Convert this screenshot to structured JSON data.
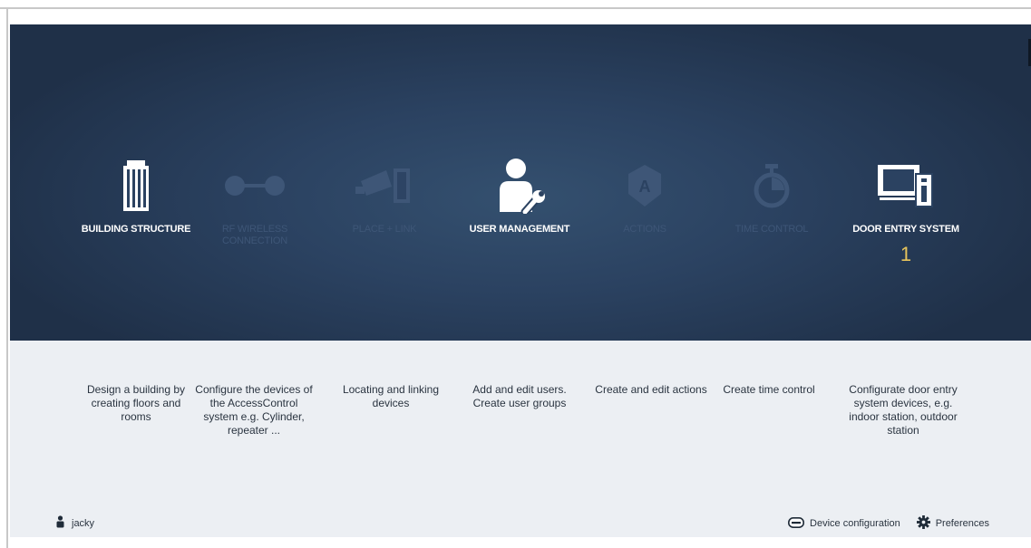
{
  "tiles": [
    {
      "label": "BUILDING STRUCTURE",
      "icon": "building-icon",
      "enabled": true,
      "description": "Design a building by creating floors and rooms"
    },
    {
      "label": "RF WIRELESS CONNECTION",
      "icon": "rf-connection-icon",
      "enabled": false,
      "description": "Configure the devices of the AccessControl system e.g. Cylinder, repeater ..."
    },
    {
      "label": "PLACE + LINK",
      "icon": "place-link-icon",
      "enabled": false,
      "description": "Locating and linking devices"
    },
    {
      "label": "USER MANAGEMENT",
      "icon": "user-management-icon",
      "enabled": true,
      "description": "Add and edit users. Create user groups"
    },
    {
      "label": "ACTIONS",
      "icon": "actions-icon",
      "enabled": false,
      "description": "Create and edit actions"
    },
    {
      "label": "TIME CONTROL",
      "icon": "stopwatch-icon",
      "enabled": false,
      "description": "Create time control"
    },
    {
      "label": "DOOR ENTRY SYSTEM",
      "icon": "door-entry-icon",
      "enabled": true,
      "badge": "1",
      "description": "Configurate door entry system devices, e.g. indoor station, outdoor station"
    }
  ],
  "footer": {
    "user": "jacky",
    "device_configuration": "Device configuration",
    "preferences": "Preferences"
  },
  "colors": {
    "hero_center": "#34506f",
    "hero_edge": "#1f3048",
    "disabled": "#3e5677",
    "badge": "#e7c45c"
  }
}
